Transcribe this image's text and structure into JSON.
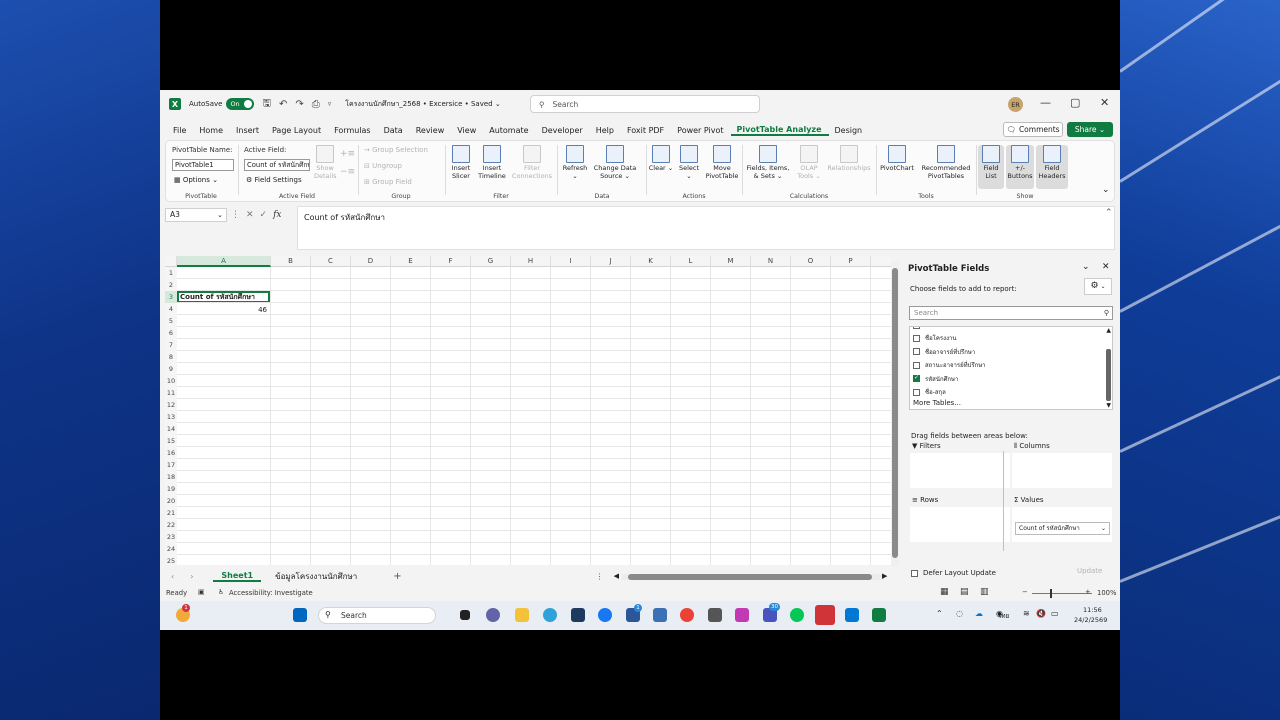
{
  "titlebar": {
    "autosave_label": "AutoSave",
    "autosave_state": "On",
    "doc_title": "โครงงานนักศึกษา_2568 • Excersice • Saved ⌄",
    "search_placeholder": "Search",
    "avatar_initials": "ER",
    "minimize": "—",
    "restore": "▢",
    "close": "✕"
  },
  "menu": {
    "tabs": [
      "File",
      "Home",
      "Insert",
      "Page Layout",
      "Formulas",
      "Data",
      "Review",
      "View",
      "Automate",
      "Developer",
      "Help",
      "Foxit PDF",
      "Power Pivot",
      "PivotTable Analyze",
      "Design"
    ],
    "active_index": 13,
    "comments": "Comments",
    "share": "Share ⌄"
  },
  "ribbon": {
    "pivottable_name_label": "PivotTable Name:",
    "pivottable_name_value": "PivotTable1",
    "options": "Options ⌄",
    "group_pivottable": "PivotTable",
    "active_field_label": "Active Field:",
    "active_field_value": "Count of รหัสนักศึกษา",
    "field_settings": "Field Settings",
    "show_details": "Show Details",
    "group_active_field": "Active Field",
    "group_selection": "→ Group Selection",
    "ungroup": "Ungroup",
    "group_field": "Group Field",
    "group_group": "Group",
    "insert_slicer": "Insert Slicer",
    "insert_timeline": "Insert Timeline",
    "filter_connections": "Filter Connections",
    "group_filter": "Filter",
    "refresh": "Refresh ⌄",
    "change_data_source": "Change Data Source ⌄",
    "group_data": "Data",
    "clear": "Clear ⌄",
    "select": "Select ⌄",
    "move_pivottable": "Move PivotTable",
    "group_actions": "Actions",
    "fields_items_sets": "Fields, Items, & Sets ⌄",
    "olap_tools": "OLAP Tools ⌄",
    "relationships": "Relationships",
    "group_calculations": "Calculations",
    "pivotchart": "PivotChart",
    "recommended_pivottables": "Recommended PivotTables",
    "group_tools": "Tools",
    "field_list": "Field List",
    "buttons": "+/- Buttons",
    "field_headers": "Field Headers",
    "group_show": "Show"
  },
  "formula_bar": {
    "name_box": "A3",
    "fx": "fx",
    "formula": "Count of รหัสนักศึกษา"
  },
  "grid": {
    "columns": [
      "A",
      "B",
      "C",
      "D",
      "E",
      "F",
      "G",
      "H",
      "I",
      "J",
      "K",
      "L",
      "M",
      "N",
      "O",
      "P"
    ],
    "rows": [
      "1",
      "2",
      "3",
      "4",
      "5",
      "6",
      "7",
      "8",
      "9",
      "10",
      "11",
      "12",
      "13",
      "14",
      "15",
      "16",
      "17",
      "18",
      "19",
      "20",
      "21",
      "22",
      "23",
      "24",
      "25"
    ],
    "a3": "Count of รหัสนักศึกษา",
    "a4": "46"
  },
  "sheets": {
    "tabs": [
      "Sheet1",
      "ข้อมูลโครงงานนักศึกษา"
    ],
    "add": "+"
  },
  "status": {
    "ready": "Ready",
    "accessibility": "Accessibility: Investigate",
    "zoom": "100%"
  },
  "pivot_pane": {
    "title": "PivotTable Fields",
    "subtitle": "Choose fields to add to report:",
    "search_placeholder": "Search",
    "fields": [
      {
        "label": "ชื่อโครงงาน",
        "checked": false
      },
      {
        "label": "ชื่ออาจารย์ที่ปรึกษา",
        "checked": false
      },
      {
        "label": "สถานะอาจารย์ที่ปรึกษา",
        "checked": false
      },
      {
        "label": "รหัสนักศึกษา",
        "checked": true
      },
      {
        "label": "ชื่อ-สกุล",
        "checked": false
      }
    ],
    "more_tables": "More Tables...",
    "drag_hint": "Drag fields between areas below:",
    "filters": "Filters",
    "columns": "Columns",
    "rows": "Rows",
    "values": "Values",
    "values_chip": "Count of รหัสนักศึกษา",
    "defer": "Defer Layout Update",
    "update": "Update"
  },
  "taskbar": {
    "search": "Search",
    "lang": "ไทย",
    "time": "11:56",
    "date": "24/2/2569",
    "badge_weather": "1",
    "badge_store": "1",
    "badge_teams": "30"
  }
}
